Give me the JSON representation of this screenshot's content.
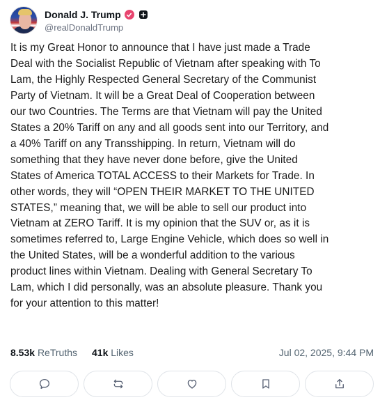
{
  "post": {
    "author": {
      "display_name": "Donald J. Trump",
      "handle": "@realDonaldTrump",
      "verified_badge_color": "#e8456f"
    },
    "lines": [
      "It is my Great Honor to announce that I have just made a Trade",
      "Deal with the Socialist Republic of Vietnam after speaking with To",
      "Lam, the Highly Respected General Secretary of the Communist",
      "Party of Vietnam. It will be a Great Deal of Cooperation between",
      "our two Countries. The Terms are that Vietnam will pay the United",
      "States a 20% Tariff on any and all goods sent into our Territory, and",
      "a 40% Tariff on any Transshipping. In return, Vietnam will do",
      "something that they have never done before, give the United",
      "States of America TOTAL ACCESS to their Markets for Trade. In",
      "other words, they will “OPEN THEIR MARKET TO THE UNITED",
      "STATES,” meaning that, we will be able to sell our product into",
      "Vietnam at ZERO Tariff. It is my opinion that the SUV or, as it is",
      "sometimes referred to, Large Engine Vehicle, which does so well in",
      "the United States, will be a wonderful addition to the various",
      "product lines within Vietnam. Dealing with General Secretary To",
      "Lam, which I did personally, was an absolute pleasure. Thank you",
      "for your attention to this matter!"
    ],
    "stats": {
      "retruths_count": "8.53k",
      "retruths_label": "ReTruths",
      "likes_count": "41k",
      "likes_label": "Likes",
      "timestamp": "Jul 02, 2025, 9:44 PM"
    },
    "actions": [
      {
        "name": "reply",
        "icon": "comment-icon"
      },
      {
        "name": "retruth",
        "icon": "repost-icon"
      },
      {
        "name": "like",
        "icon": "heart-icon"
      },
      {
        "name": "bookmark",
        "icon": "bookmark-icon"
      },
      {
        "name": "share",
        "icon": "share-icon"
      }
    ]
  }
}
